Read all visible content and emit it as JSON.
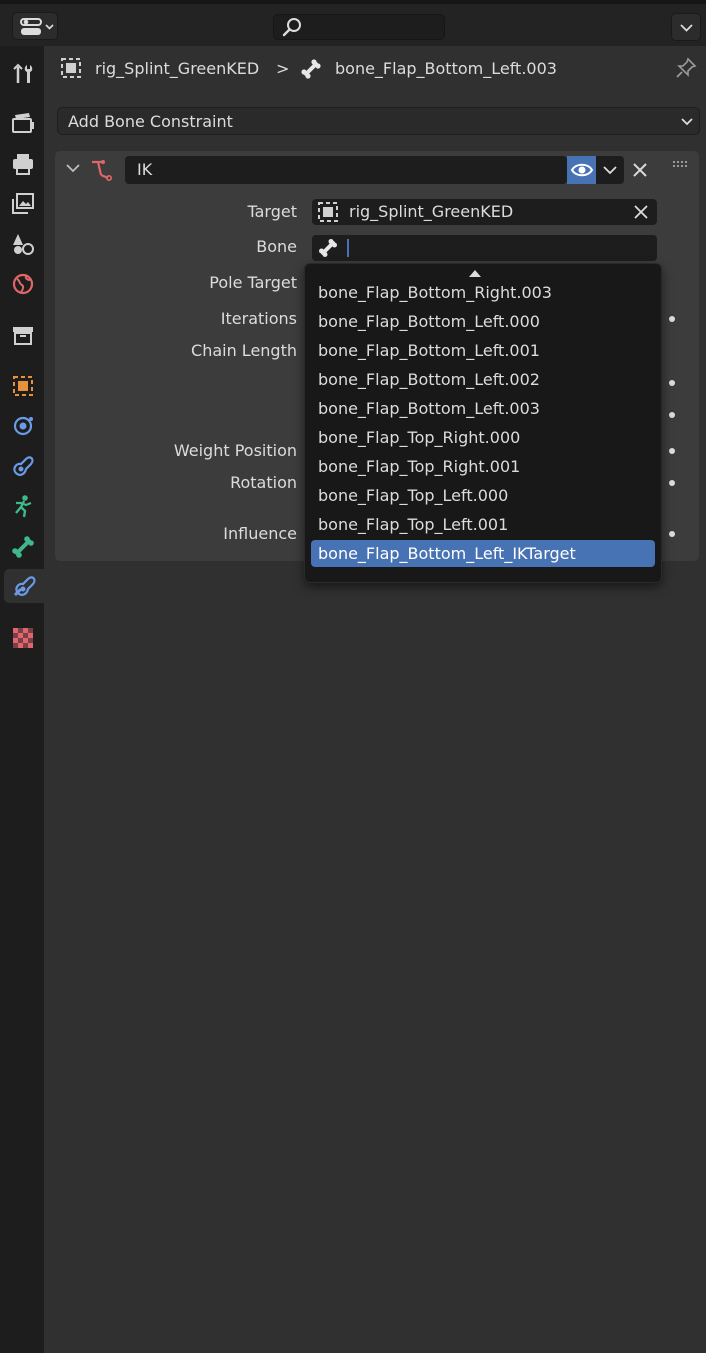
{
  "topbar": {
    "editor_type_icon": "properties-editor-icon",
    "search_icon": "search-icon",
    "dropdown_icon": "chevron-down-icon"
  },
  "sidebar": {
    "tabs": [
      {
        "name": "tool",
        "icon": "tool-icon"
      },
      {
        "name": "render",
        "icon": "render-icon"
      },
      {
        "name": "output",
        "icon": "output-icon"
      },
      {
        "name": "view-layer",
        "icon": "view-layer-icon"
      },
      {
        "name": "scene",
        "icon": "scene-icon"
      },
      {
        "name": "world",
        "icon": "world-icon"
      },
      {
        "name": "collection",
        "icon": "collection-icon"
      },
      {
        "name": "object",
        "icon": "object-icon"
      },
      {
        "name": "physics",
        "icon": "physics-icon"
      },
      {
        "name": "object-constraints",
        "icon": "object-constraint-icon"
      },
      {
        "name": "object-data",
        "icon": "armature-data-icon"
      },
      {
        "name": "bone",
        "icon": "bone-icon"
      },
      {
        "name": "bone-constraints",
        "icon": "bone-constraint-icon",
        "active": true
      },
      {
        "name": "texture",
        "icon": "texture-icon"
      }
    ]
  },
  "breadcrumb": {
    "object_name": "rig_Splint_GreenKED",
    "separator": ">",
    "bone_name": "bone_Flap_Bottom_Left.003"
  },
  "add_constraint": {
    "label": "Add Bone Constraint"
  },
  "constraint": {
    "name": "IK",
    "labels": {
      "target": "Target",
      "bone": "Bone",
      "pole_target": "Pole Target",
      "iterations": "Iterations",
      "chain_length": "Chain Length",
      "weight_position": "Weight Position",
      "rotation": "Rotation",
      "influence": "Influence"
    },
    "target_value": "rig_Splint_GreenKED",
    "bone_value": ""
  },
  "bone_dropdown": {
    "items": [
      "bone_Flap_Bottom_Right.003",
      "bone_Flap_Bottom_Left.000",
      "bone_Flap_Bottom_Left.001",
      "bone_Flap_Bottom_Left.002",
      "bone_Flap_Bottom_Left.003",
      "bone_Flap_Top_Right.000",
      "bone_Flap_Top_Right.001",
      "bone_Flap_Top_Left.000",
      "bone_Flap_Top_Left.001",
      "bone_Flap_Bottom_Left_IKTarget"
    ],
    "selected_index": 9
  },
  "colors": {
    "accent": "#4772b3",
    "constraint_icon": "#e06767",
    "bone_tab": "#3fb88c",
    "object_orange": "#e8913c"
  }
}
